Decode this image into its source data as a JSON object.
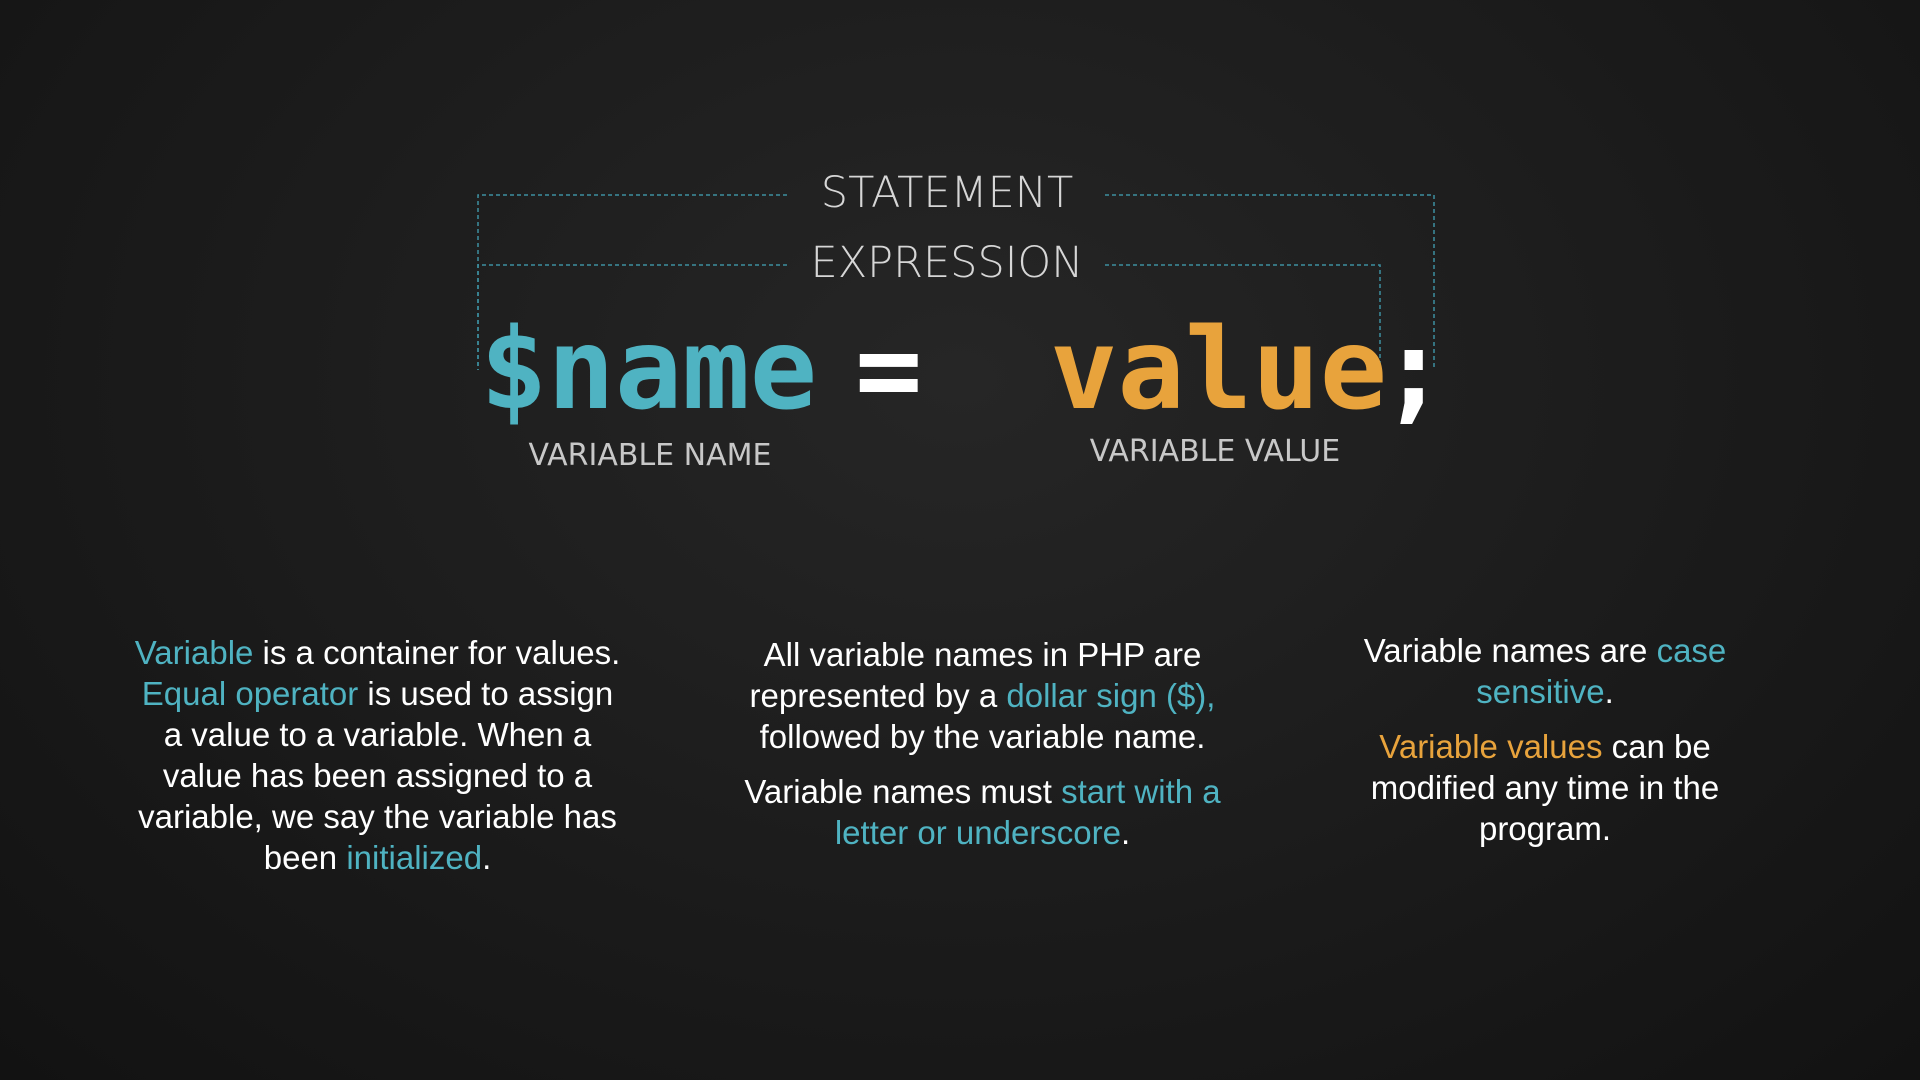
{
  "diagram": {
    "statement_label": "STATEMENT",
    "expression_label": "EXPRESSION",
    "code": {
      "variable": "$name",
      "operator": "=",
      "value": "value",
      "terminator": ";"
    },
    "variable_name_label": "VARIABLE NAME",
    "variable_value_label": "VARIABLE VALUE"
  },
  "columns": [
    {
      "paragraphs": [
        [
          {
            "text": "Variable",
            "color": "teal"
          },
          {
            "text": " is a container for values. "
          },
          {
            "text": "Equal operator",
            "color": "teal"
          },
          {
            "text": " is used to assign a value to a variable. When a value has been assigned to a variable, we say the variable has been "
          },
          {
            "text": "initialized",
            "color": "teal"
          },
          {
            "text": "."
          }
        ]
      ]
    },
    {
      "paragraphs": [
        [
          {
            "text": "All variable names in PHP are represented by a "
          },
          {
            "text": "dollar sign ($),",
            "color": "teal"
          },
          {
            "text": " followed by the variable name."
          }
        ],
        [
          {
            "text": "Variable names must "
          },
          {
            "text": "start with a letter or underscore",
            "color": "teal"
          },
          {
            "text": "."
          }
        ]
      ]
    },
    {
      "paragraphs": [
        [
          {
            "text": "Variable names are "
          },
          {
            "text": "case sensitive",
            "color": "teal"
          },
          {
            "text": "."
          }
        ],
        [
          {
            "text": "Variable values",
            "color": "orange"
          },
          {
            "text": " can be modified any time in the program."
          }
        ]
      ]
    }
  ],
  "colors": {
    "teal": "#4fb3c2",
    "orange": "#e8a33c",
    "text": "#ffffff",
    "label": "#c8c8c8",
    "bracket": "#3d8fa0"
  }
}
